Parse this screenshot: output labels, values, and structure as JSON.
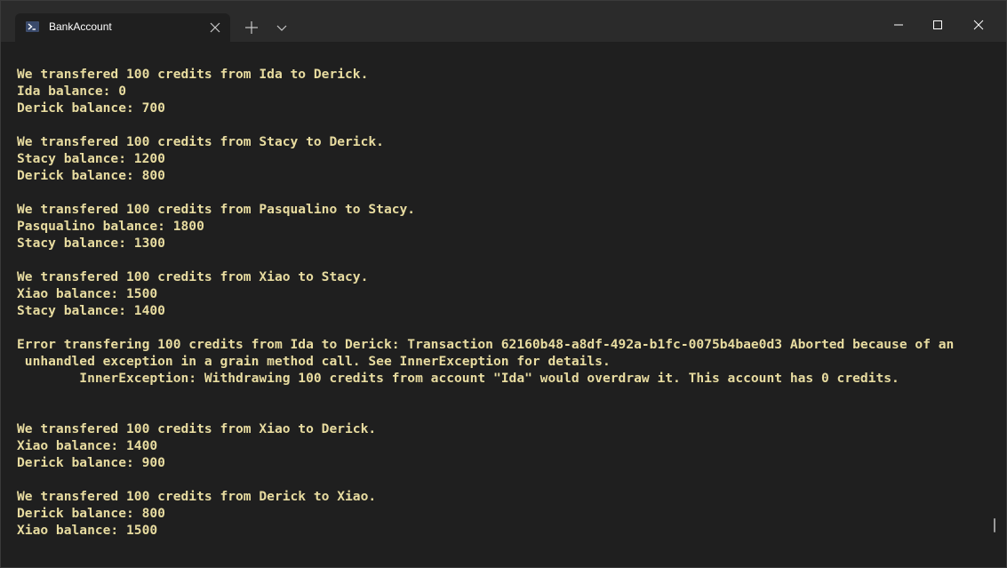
{
  "window": {
    "tab_title": "BankAccount",
    "tab_icon": "powershell-icon",
    "buttons": {
      "new_tab": "plus-icon",
      "dropdown": "chevron-down-icon",
      "minimize": "minimize-icon",
      "maximize": "maximize-icon",
      "close": "close-icon"
    }
  },
  "terminal": {
    "text_color": "#e8dca0",
    "background": "#1f1f1f",
    "lines": [
      "We transfered 100 credits from Ida to Derick.",
      "Ida balance: 0",
      "Derick balance: 700",
      "",
      "We transfered 100 credits from Stacy to Derick.",
      "Stacy balance: 1200",
      "Derick balance: 800",
      "",
      "We transfered 100 credits from Pasqualino to Stacy.",
      "Pasqualino balance: 1800",
      "Stacy balance: 1300",
      "",
      "We transfered 100 credits from Xiao to Stacy.",
      "Xiao balance: 1500",
      "Stacy balance: 1400",
      "",
      "Error transfering 100 credits from Ida to Derick: Transaction 62160b48-a8df-492a-b1fc-0075b4bae0d3 Aborted because of an",
      " unhandled exception in a grain method call. See InnerException for details.",
      "        InnerException: Withdrawing 100 credits from account \"Ida\" would overdraw it. This account has 0 credits.",
      "",
      "",
      "We transfered 100 credits from Xiao to Derick.",
      "Xiao balance: 1400",
      "Derick balance: 900",
      "",
      "We transfered 100 credits from Derick to Xiao.",
      "Derick balance: 800",
      "Xiao balance: 1500"
    ]
  }
}
